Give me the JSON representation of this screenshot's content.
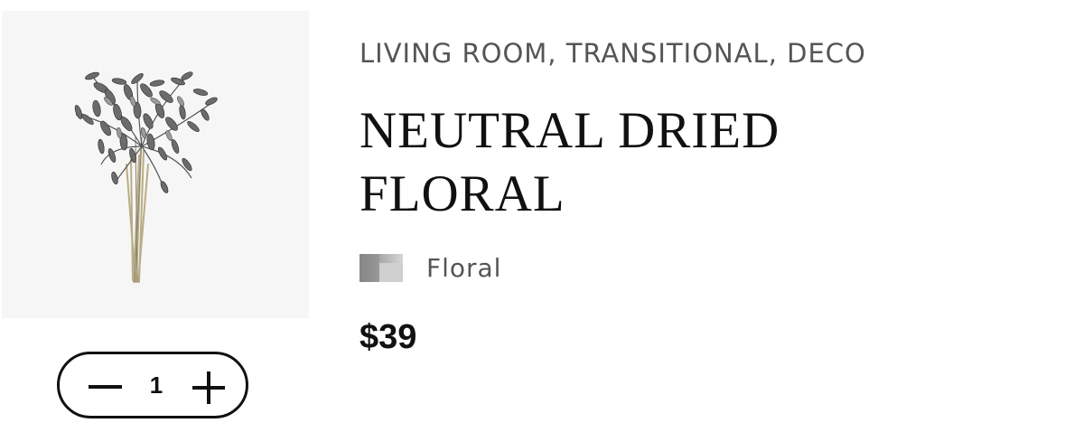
{
  "product": {
    "image_alt": "Neutral dried floral bouquet",
    "categories": "LIVING ROOM, TRANSITIONAL, DECO",
    "title": "NEUTRAL DRIED FLORAL",
    "swatch": {
      "label": "Floral",
      "colors": [
        "#808080",
        "#d6d6d6"
      ]
    },
    "price": "$39"
  },
  "cart": {
    "quantity": "1"
  },
  "icons": {
    "decrease": "minus-icon",
    "increase": "plus-icon"
  },
  "colors": {
    "text": "#111111",
    "muted_text": "#555555",
    "image_background": "#f6f6f6"
  }
}
